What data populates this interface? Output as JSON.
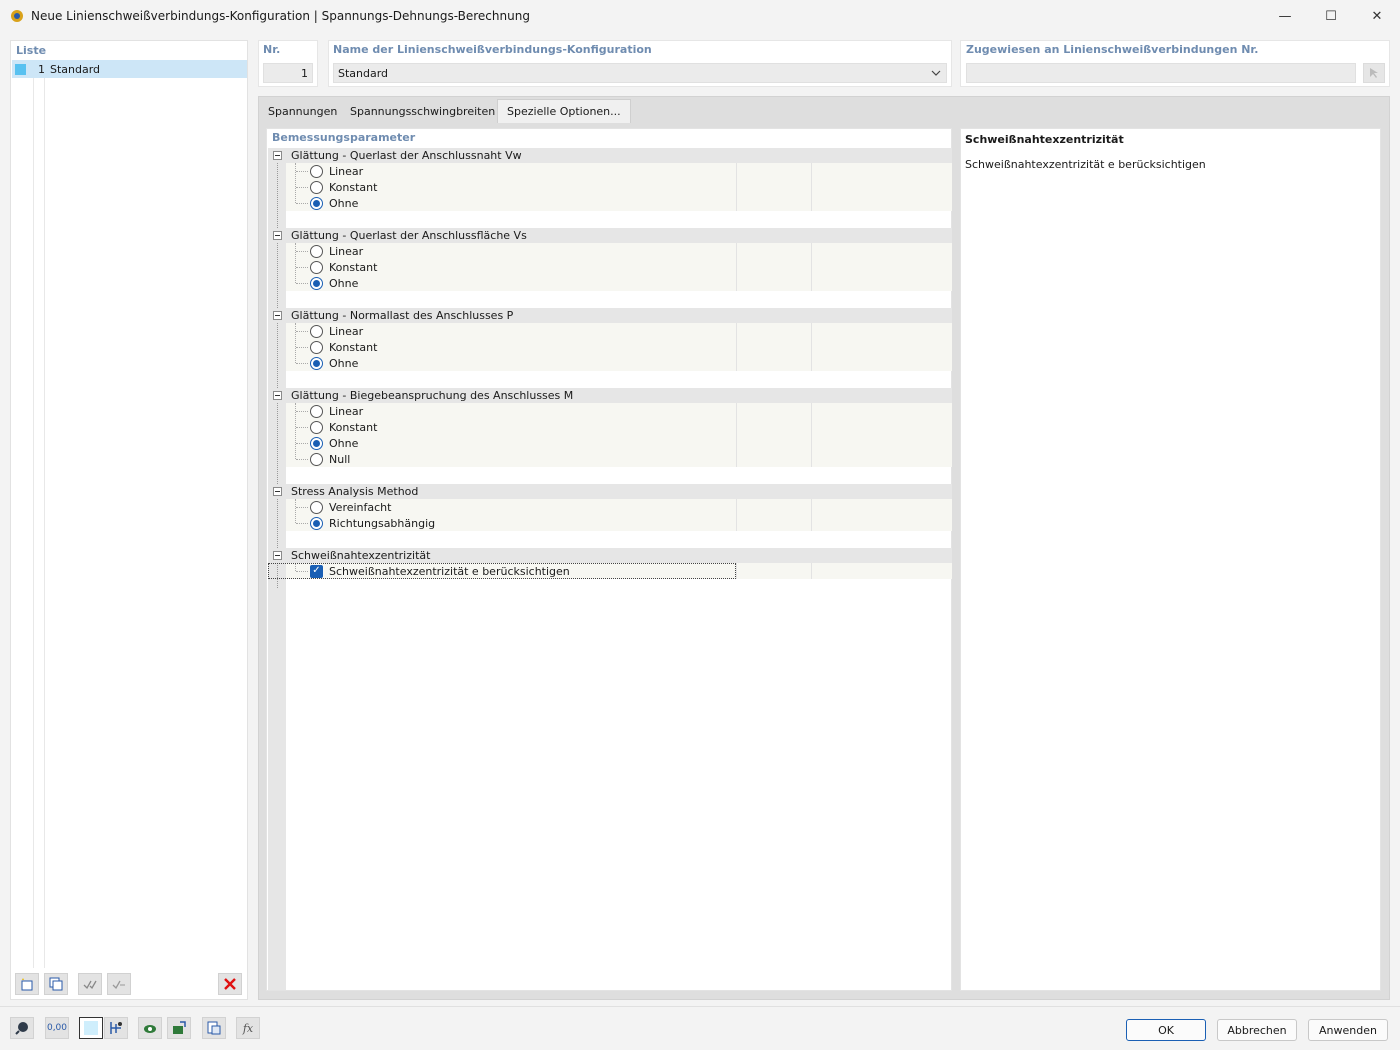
{
  "window": {
    "title": "Neue Linienschweißverbindungs-Konfiguration | Spannungs-Dehnungs-Berechnung",
    "controls": {
      "minimize": "—",
      "maximize": "☐",
      "close": "✕"
    }
  },
  "list": {
    "header": "Liste",
    "items": [
      {
        "number": "1",
        "name": "Standard"
      }
    ]
  },
  "header": {
    "nr_label": "Nr.",
    "nr_value": "1",
    "name_label": "Name der Linienschweißverbindungs-Konfiguration",
    "name_value": "Standard",
    "assigned_label": "Zugewiesen an Linienschweißverbindungen Nr.",
    "assigned_value": ""
  },
  "tabs": [
    {
      "label": "Spannungen",
      "active": false
    },
    {
      "label": "Spannungsschwingbreiten",
      "active": false
    },
    {
      "label": "Spezielle Optionen...",
      "active": true
    }
  ],
  "settings": {
    "section_label": "Bemessungsparameter",
    "groups": [
      {
        "title": "Glättung - Querlast der Anschlussnaht Vw",
        "options": [
          {
            "label": "Linear",
            "selected": false
          },
          {
            "label": "Konstant",
            "selected": false
          },
          {
            "label": "Ohne",
            "selected": true
          }
        ]
      },
      {
        "title": "Glättung - Querlast der Anschlussfläche Vs",
        "options": [
          {
            "label": "Linear",
            "selected": false
          },
          {
            "label": "Konstant",
            "selected": false
          },
          {
            "label": "Ohne",
            "selected": true
          }
        ]
      },
      {
        "title": "Glättung - Normallast des Anschlusses P",
        "options": [
          {
            "label": "Linear",
            "selected": false
          },
          {
            "label": "Konstant",
            "selected": false
          },
          {
            "label": "Ohne",
            "selected": true
          }
        ]
      },
      {
        "title": "Glättung - Biegebeanspruchung des Anschlusses M",
        "options": [
          {
            "label": "Linear",
            "selected": false
          },
          {
            "label": "Konstant",
            "selected": false
          },
          {
            "label": "Ohne",
            "selected": true
          },
          {
            "label": "Null",
            "selected": false
          }
        ]
      },
      {
        "title": "Stress Analysis Method",
        "options": [
          {
            "label": "Vereinfacht",
            "selected": false
          },
          {
            "label": "Richtungsabhängig",
            "selected": true
          }
        ]
      },
      {
        "title": "Schweißnahtexzentrizität",
        "checkbox": {
          "label": "Schweißnahtexzentrizität e berücksichtigen",
          "checked": true
        }
      }
    ]
  },
  "info": {
    "title": "Schweißnahtexzentrizität",
    "text": "Schweißnahtexzentrizität e berücksichtigen"
  },
  "buttons": {
    "ok": "OK",
    "cancel": "Abbrechen",
    "apply": "Anwenden"
  },
  "icons": {
    "bottom_tools": [
      "search-icon",
      "units-icon",
      "color-icon",
      "model-icon",
      "view-icon",
      "export-icon",
      "table-icon",
      "formula-icon"
    ],
    "units_text": "0,00",
    "formula_text": "fx"
  }
}
